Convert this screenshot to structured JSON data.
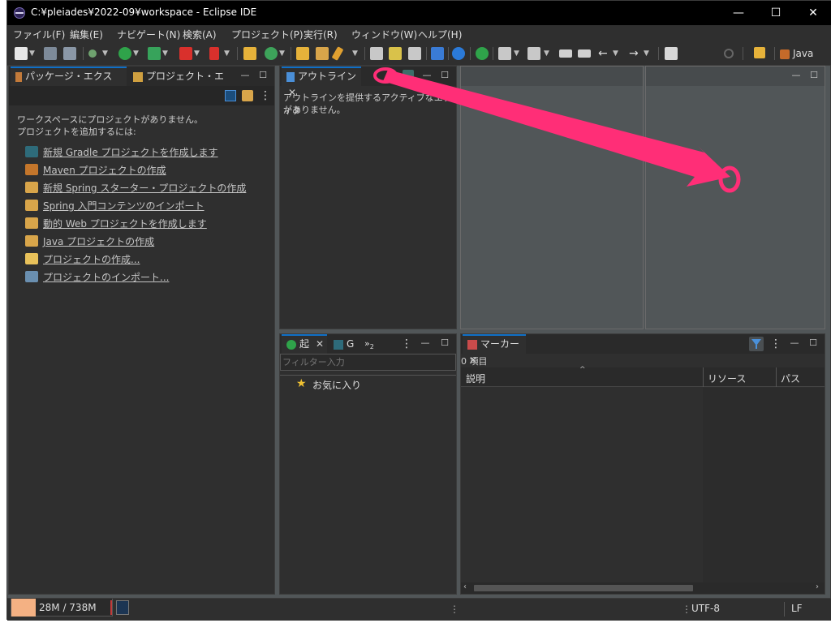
{
  "window": {
    "title": "C:¥pleiades¥2022-09¥workspace - Eclipse IDE",
    "minimize_glyph": "—",
    "maximize_glyph": "☐",
    "close_glyph": "✕"
  },
  "menu": [
    "ファイル(F)",
    "編集(E)",
    "ナビゲート(N)",
    "検索(A)",
    "プロジェクト(P)",
    "実行(R)",
    "ウィンドウ(W)",
    "ヘルプ(H)"
  ],
  "toolbar": {
    "perspective_label": "Java"
  },
  "package_explorer": {
    "tab_label": "パッケージ・エクスプ...",
    "tab2_label": "プロジェクト・エクス...",
    "empty_line1": "ワークスペースにプロジェクトがありません。",
    "empty_line2": "プロジェクトを追加するには:",
    "links": [
      {
        "label": "新規 Gradle プロジェクトを作成します",
        "icon": "gradle-icon",
        "color": "#2e6b7a"
      },
      {
        "label": "Maven プロジェクトの作成",
        "icon": "maven-icon",
        "color": "#c4762b"
      },
      {
        "label": "新規 Spring スターター・プロジェクトの作成",
        "icon": "spring-starter-icon",
        "color": "#d8a54a"
      },
      {
        "label": "Spring 入門コンテンツのインポート",
        "icon": "spring-import-icon",
        "color": "#d8a54a"
      },
      {
        "label": "動的 Web プロジェクトを作成します",
        "icon": "web-project-icon",
        "color": "#d8a54a"
      },
      {
        "label": "Java プロジェクトの作成",
        "icon": "java-project-icon",
        "color": "#d8a54a"
      },
      {
        "label": "プロジェクトの作成...",
        "icon": "new-project-icon",
        "color": "#e8c15a"
      },
      {
        "label": "プロジェクトのインポート...",
        "icon": "import-icon",
        "color": "#6a8fb0"
      }
    ]
  },
  "outline": {
    "tab_label": "アウトライン",
    "message_line1": "アウトラインを提供するアクティブなエディタ",
    "message_line2": "がありません。"
  },
  "launch": {
    "tab1_label": "起",
    "tab2_label": "G",
    "overflow_label": "»",
    "overflow_count": "2",
    "filter_placeholder": "フィルター入力",
    "favorites_label": "お気に入り"
  },
  "markers": {
    "tab_label": "マーカー",
    "count_text": "0 項目",
    "columns": [
      "説明",
      "リソース",
      "パス"
    ]
  },
  "status": {
    "heap": "28M / 738M",
    "heap_fraction": 0.038,
    "encoding": "UTF-8",
    "line_delimiter": "LF"
  },
  "colors": {
    "accent": "#0f6fc6",
    "annotation": "#ff2e77",
    "heap_bar": "#f4b183"
  }
}
